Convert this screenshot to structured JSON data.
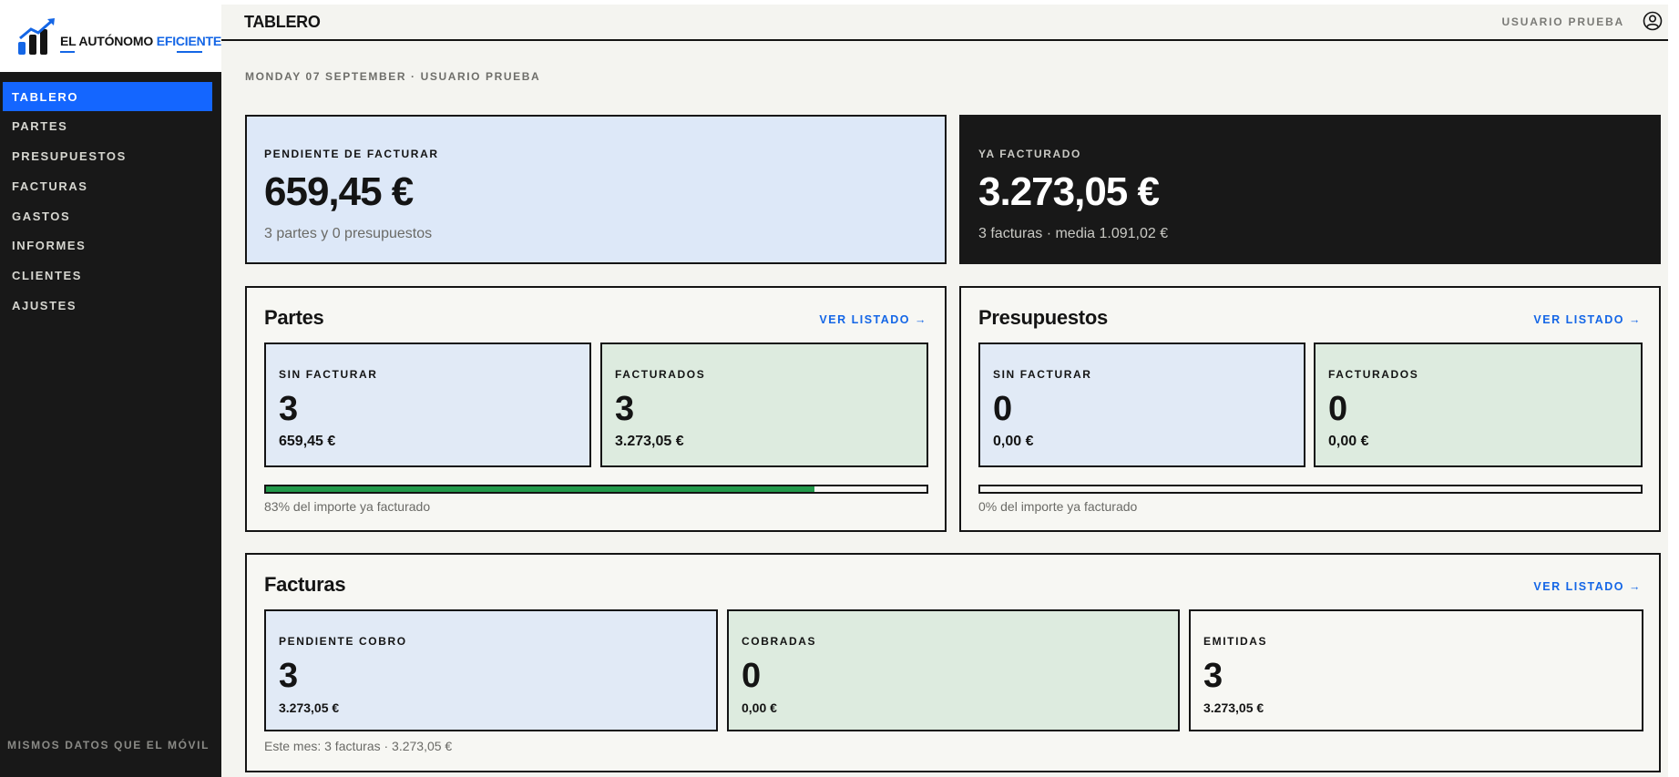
{
  "brand": {
    "name_part1": "EL AUTÓNOMO ",
    "name_part2": "EFICIENTE",
    "accent_color": "#1466e6"
  },
  "sidebar": {
    "items": [
      {
        "label": "TABLERO",
        "active": true
      },
      {
        "label": "PARTES"
      },
      {
        "label": "PRESUPUESTOS"
      },
      {
        "label": "FACTURAS"
      },
      {
        "label": "GASTOS"
      },
      {
        "label": "INFORMES"
      },
      {
        "label": "CLIENTES"
      },
      {
        "label": "AJUSTES"
      }
    ],
    "footer": "MISMOS DATOS QUE EL MÓVIL"
  },
  "header": {
    "title": "TABLERO",
    "user": "USUARIO PRUEBA",
    "user_icon": "user-circle-icon"
  },
  "date_line": "MONDAY 07 SEPTEMBER · USUARIO PRUEBA",
  "hero": {
    "pending": {
      "label": "PENDIENTE DE FACTURAR",
      "value": "659,45 €",
      "sub": "3 partes y 0 presupuestos"
    },
    "invoiced": {
      "label": "YA FACTURADO",
      "value": "3.273,05 €",
      "sub": "3 facturas · media 1.091,02 €"
    }
  },
  "partes": {
    "title": "Partes",
    "link": "VER LISTADO →",
    "sin_facturar": {
      "label": "SIN FACTURAR",
      "count": "3",
      "amount": "659,45 €"
    },
    "facturados": {
      "label": "FACTURADOS",
      "count": "3",
      "amount": "3.273,05 €"
    },
    "progress_percent": 83,
    "progress_caption": "83% del importe ya facturado"
  },
  "presupuestos": {
    "title": "Presupuestos",
    "link": "VER LISTADO →",
    "sin_facturar": {
      "label": "SIN FACTURAR",
      "count": "0",
      "amount": "0,00 €"
    },
    "facturados": {
      "label": "FACTURADOS",
      "count": "0",
      "amount": "0,00 €"
    },
    "progress_percent": 0,
    "progress_caption": "0% del importe ya facturado"
  },
  "facturas": {
    "title": "Facturas",
    "link": "VER LISTADO →",
    "pendiente": {
      "label": "PENDIENTE COBRO",
      "count": "3",
      "amount": "3.273,05 €"
    },
    "cobradas": {
      "label": "COBRADAS",
      "count": "0",
      "amount": "0,00 €"
    },
    "emitidas": {
      "label": "EMITIDAS",
      "count": "3",
      "amount": "3.273,05 €"
    },
    "caption": "Este mes: 3 facturas · 3.273,05 €"
  },
  "colors": {
    "sidebar_bg": "#181818",
    "active_nav": "#1466ff",
    "pending_bg": "#dde8f8",
    "invoiced_bg": "#181818",
    "progress_fill": "#22994a"
  }
}
